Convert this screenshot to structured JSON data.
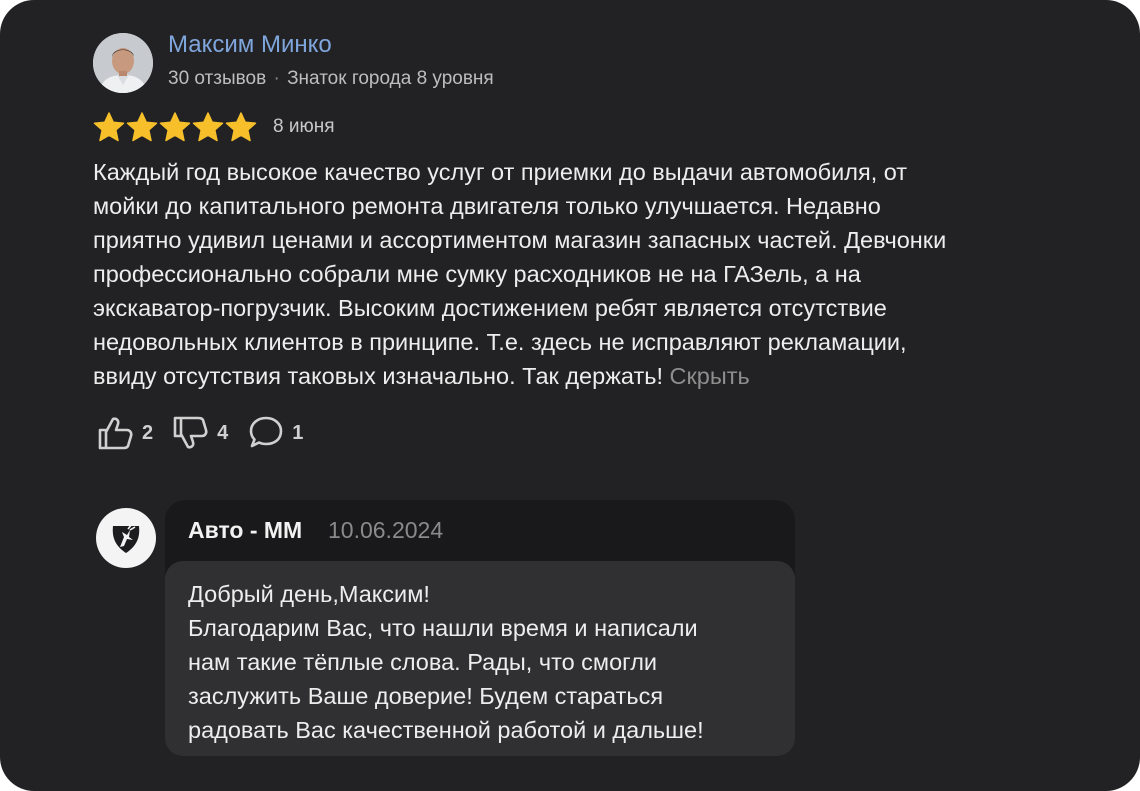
{
  "review": {
    "author": {
      "name": "Максим Минко",
      "reviews_count": "30 отзывов",
      "separator": "·",
      "badge": "Знаток города 8 уровня",
      "avatar_icon": "user-photo"
    },
    "rating": {
      "value": 5,
      "max": 5,
      "star_color": "#f7c02a"
    },
    "date": "8 июня",
    "text_lines": [
      "Каждый год высокое качество услуг от приемки до выдачи автомобиля, от",
      "мойки до капитального ремонта двигателя только улучшается. Недавно",
      "приятно удивил ценами и ассортиментом магазин запасных частей. Девчонки",
      "профессионально собрали мне сумку расходников не на ГАЗель, а на",
      "экскаватор-погрузчик. Высоким достижением ребят является отсутствие",
      "недовольных клиентов в принципе. Т.е. здесь не исправляют рекламации,",
      "ввиду отсутствия таковых изначально. Так держать!"
    ],
    "hide_link": "Скрыть",
    "reactions": {
      "likes": "2",
      "dislikes": "4",
      "comments": "1"
    }
  },
  "reply": {
    "company": "Авто - ММ",
    "date": "10.06.2024",
    "logo_icon": "gaz-deer-logo",
    "text_lines": [
      "Добрый день,Максим!",
      "Благодарим Вас, что нашли время и написали",
      "нам такие тёплые слова. Рады, что смогли",
      "заслужить Ваше доверие! Будем стараться",
      "радовать Вас качественной работой и дальше!"
    ]
  },
  "colors": {
    "background": "#222224",
    "author_name": "#7fa6dc",
    "muted_text": "#8e8e8e",
    "reply_bubble": "#303033"
  }
}
